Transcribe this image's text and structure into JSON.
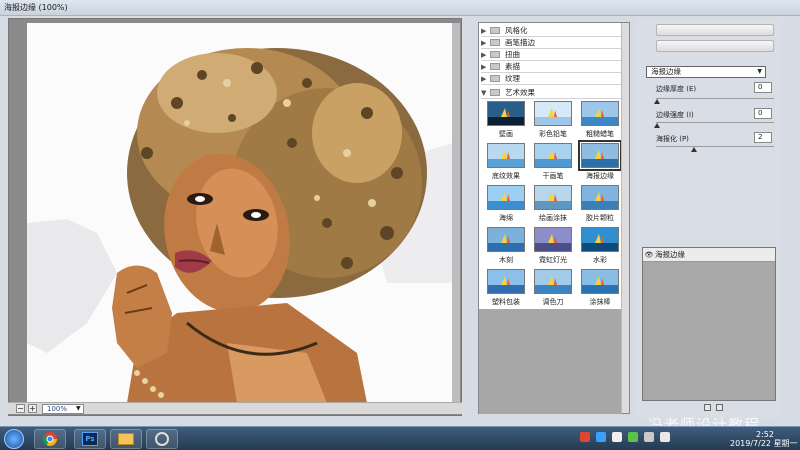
{
  "window": {
    "title": "海报边缘 (100%)"
  },
  "preview": {
    "zoom": "100%"
  },
  "gallery": {
    "categories": [
      {
        "label": "风格化",
        "expanded": false
      },
      {
        "label": "画笔描边",
        "expanded": false
      },
      {
        "label": "扭曲",
        "expanded": false
      },
      {
        "label": "素描",
        "expanded": false
      },
      {
        "label": "纹理",
        "expanded": false
      },
      {
        "label": "艺术效果",
        "expanded": true
      }
    ],
    "filters": [
      {
        "label": "壁画"
      },
      {
        "label": "彩色铅笔"
      },
      {
        "label": "粗糙蜡笔"
      },
      {
        "label": "底纹效果"
      },
      {
        "label": "干画笔"
      },
      {
        "label": "海报边缘",
        "selected": true
      },
      {
        "label": "海绵"
      },
      {
        "label": "绘画涂抹"
      },
      {
        "label": "胶片颗粒"
      },
      {
        "label": "木刻"
      },
      {
        "label": "霓虹灯光"
      },
      {
        "label": "水彩"
      },
      {
        "label": "塑料包装"
      },
      {
        "label": "调色刀"
      },
      {
        "label": "涂抹棒"
      }
    ]
  },
  "settings": {
    "filter_select": "海报边缘",
    "params": [
      {
        "label": "边缘厚度 (E)",
        "value": "0"
      },
      {
        "label": "边缘强度 (I)",
        "value": "0"
      },
      {
        "label": "海报化 (P)",
        "value": "2"
      }
    ],
    "layers": [
      {
        "name": "海报边缘"
      }
    ]
  },
  "watermark": "冯老师设计教程",
  "taskbar": {
    "time": "2:52",
    "date": "2019/7/22 星期一"
  },
  "colors": {
    "accent": "#2a4c8a",
    "taskbar": "#2f4a68"
  }
}
